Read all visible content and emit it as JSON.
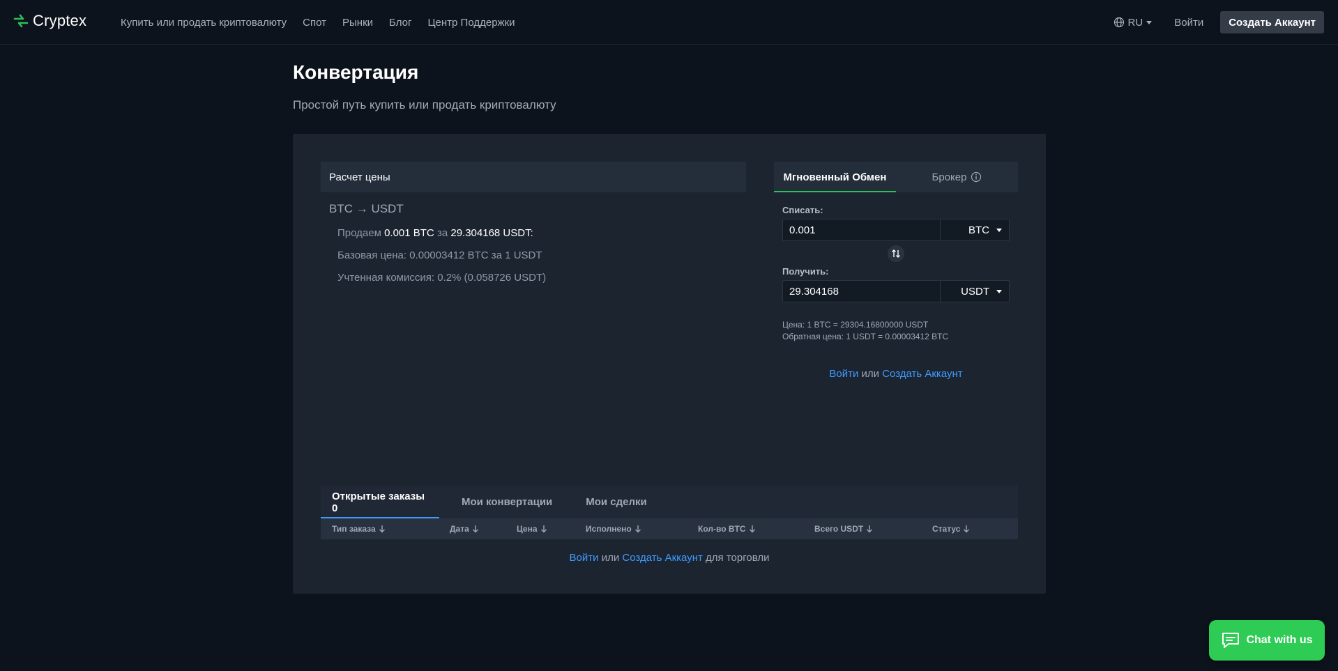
{
  "header": {
    "brand": "Cryptex",
    "nav": [
      "Купить или продать криптовалюту",
      "Спот",
      "Рынки",
      "Блог",
      "Центр Поддержки"
    ],
    "lang": "RU",
    "login": "Войти",
    "create_account": "Создать Аккаунт"
  },
  "page": {
    "title": "Конвертация",
    "subtitle": "Простой путь купить или продать криптовалюту"
  },
  "calc": {
    "header": "Расчет цены",
    "pair": "BTC → USDT",
    "sell_prefix": "Продаем",
    "sell_amount": "0.001 BTC",
    "sell_for": "за",
    "sell_total": "29.304168 USDT:",
    "base_price": "Базовая цена: 0.00003412 BTC за 1 USDT",
    "commission": "Учтенная комиссия: 0.2% (0.058726 USDT)"
  },
  "exchange": {
    "tabs": [
      "Мгновенный Обмен",
      "Брокер"
    ],
    "debit_label": "Списать:",
    "debit_value": "0.001",
    "debit_currency": "BTC",
    "receive_label": "Получить:",
    "receive_value": "29.304168",
    "receive_currency": "USDT",
    "rate": "Цена: 1 BTC = 29304.16800000 USDT",
    "reverse_rate": "Обратная цена: 1 USDT = 0.00003412 BTC",
    "auth_login": "Войти",
    "auth_or": "или",
    "auth_create": "Создать Аккаунт"
  },
  "orders": {
    "tabs": [
      "Открытые заказы 0",
      "Мои конвертации",
      "Мои сделки"
    ],
    "columns": [
      "Тип заказа",
      "Дата",
      "Цена",
      "Исполнено",
      "Кол-во BTC",
      "Всего USDT",
      "Статус"
    ],
    "auth_login": "Войти",
    "auth_or": "или",
    "auth_create": "Создать Аккаунт",
    "auth_suffix": "для торговли"
  },
  "chat": {
    "label": "Chat with us"
  },
  "colors": {
    "background": "#0d131c",
    "card": "#1c2430",
    "accent_green": "#2fbf5a",
    "link_blue": "#3f9bff",
    "chat_green": "#2ecc55"
  }
}
